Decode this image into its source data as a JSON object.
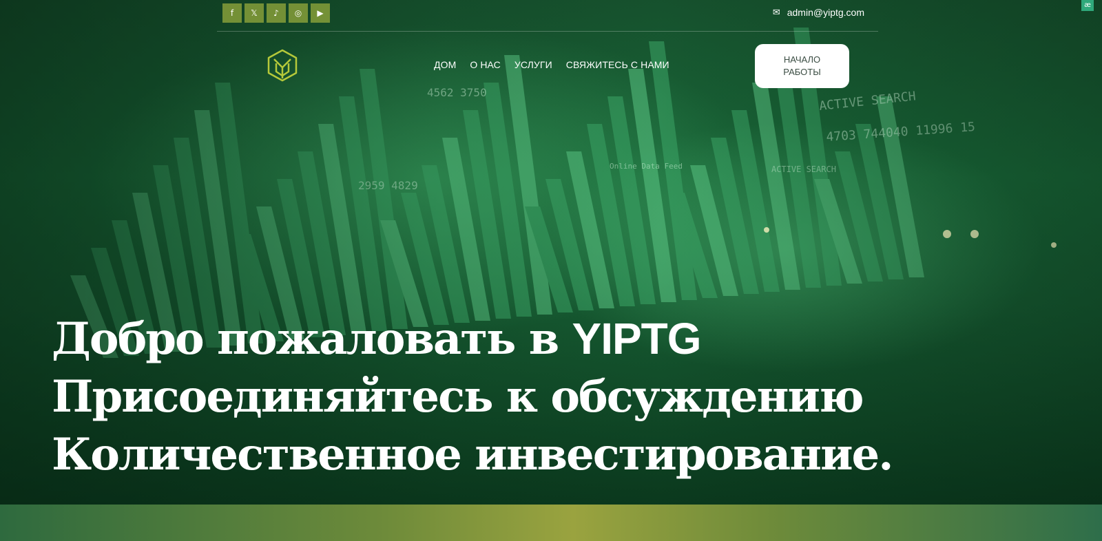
{
  "social": {
    "items": [
      {
        "icon": "facebook-icon",
        "glyph": "f"
      },
      {
        "icon": "x-twitter-icon",
        "glyph": "𝕏"
      },
      {
        "icon": "tiktok-icon",
        "glyph": "♪"
      },
      {
        "icon": "instagram-icon",
        "glyph": "◎"
      },
      {
        "icon": "youtube-icon",
        "glyph": "▶"
      }
    ]
  },
  "contact": {
    "email": "admin@yiptg.com",
    "email_icon": "envelope-icon"
  },
  "corner_badge": "æ",
  "nav": {
    "items": [
      {
        "label": "ДОМ"
      },
      {
        "label": "О НАС"
      },
      {
        "label": "УСЛУГИ"
      },
      {
        "label": "СВЯЖИТЕСЬ С НАМИ"
      }
    ],
    "cta_label": "НАЧАЛО РАБОТЫ"
  },
  "hero": {
    "line1_prefix": "Добро пожаловать в",
    "line1_brand": "YIPTG",
    "line2": "Присоединяйтесь к обсуждению",
    "line3": "Количественное инвестирование."
  },
  "colors": {
    "accent": "#b5c93a",
    "hero_green": "#1a6b3a",
    "strip_center": "#9aa33f"
  }
}
